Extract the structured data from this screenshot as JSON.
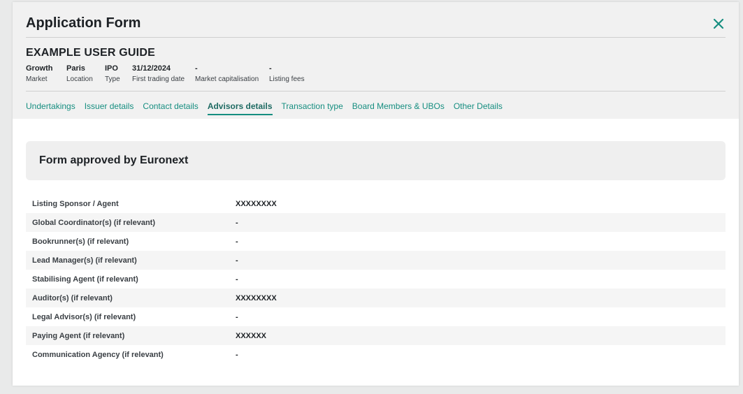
{
  "modal": {
    "title": "Application Form",
    "subtitle": "EXAMPLE USER GUIDE"
  },
  "meta": [
    {
      "value": "Growth",
      "label": "Market"
    },
    {
      "value": "Paris",
      "label": "Location"
    },
    {
      "value": "IPO",
      "label": "Type"
    },
    {
      "value": "31/12/2024",
      "label": "First trading date"
    },
    {
      "value": "-",
      "label": "Market capitalisation"
    },
    {
      "value": "-",
      "label": "Listing fees"
    }
  ],
  "tabs": [
    {
      "label": "Undertakings",
      "active": false
    },
    {
      "label": "Issuer details",
      "active": false
    },
    {
      "label": "Contact details",
      "active": false
    },
    {
      "label": "Advisors details",
      "active": true
    },
    {
      "label": "Transaction type",
      "active": false
    },
    {
      "label": "Board Members & UBOs",
      "active": false
    },
    {
      "label": "Other Details",
      "active": false
    }
  ],
  "status_banner": "Form approved by Euronext",
  "advisors": [
    {
      "label": "Listing Sponsor / Agent",
      "value": "XXXXXXXX"
    },
    {
      "label": "Global Coordinator(s) (if relevant)",
      "value": "-"
    },
    {
      "label": "Bookrunner(s) (if relevant)",
      "value": "-"
    },
    {
      "label": "Lead Manager(s) (if relevant)",
      "value": "-"
    },
    {
      "label": "Stabilising Agent (if relevant)",
      "value": "-"
    },
    {
      "label": "Auditor(s) (if relevant)",
      "value": "XXXXXXXX"
    },
    {
      "label": "Legal Advisor(s) (if relevant)",
      "value": "-"
    },
    {
      "label": "Paying Agent (if relevant)",
      "value": "XXXXXX"
    },
    {
      "label": "Communication Agency (if relevant)",
      "value": "-"
    }
  ],
  "icons": {
    "close": "close-icon"
  },
  "colors": {
    "accent": "#168e80",
    "header_bg": "#f1f1f1"
  }
}
